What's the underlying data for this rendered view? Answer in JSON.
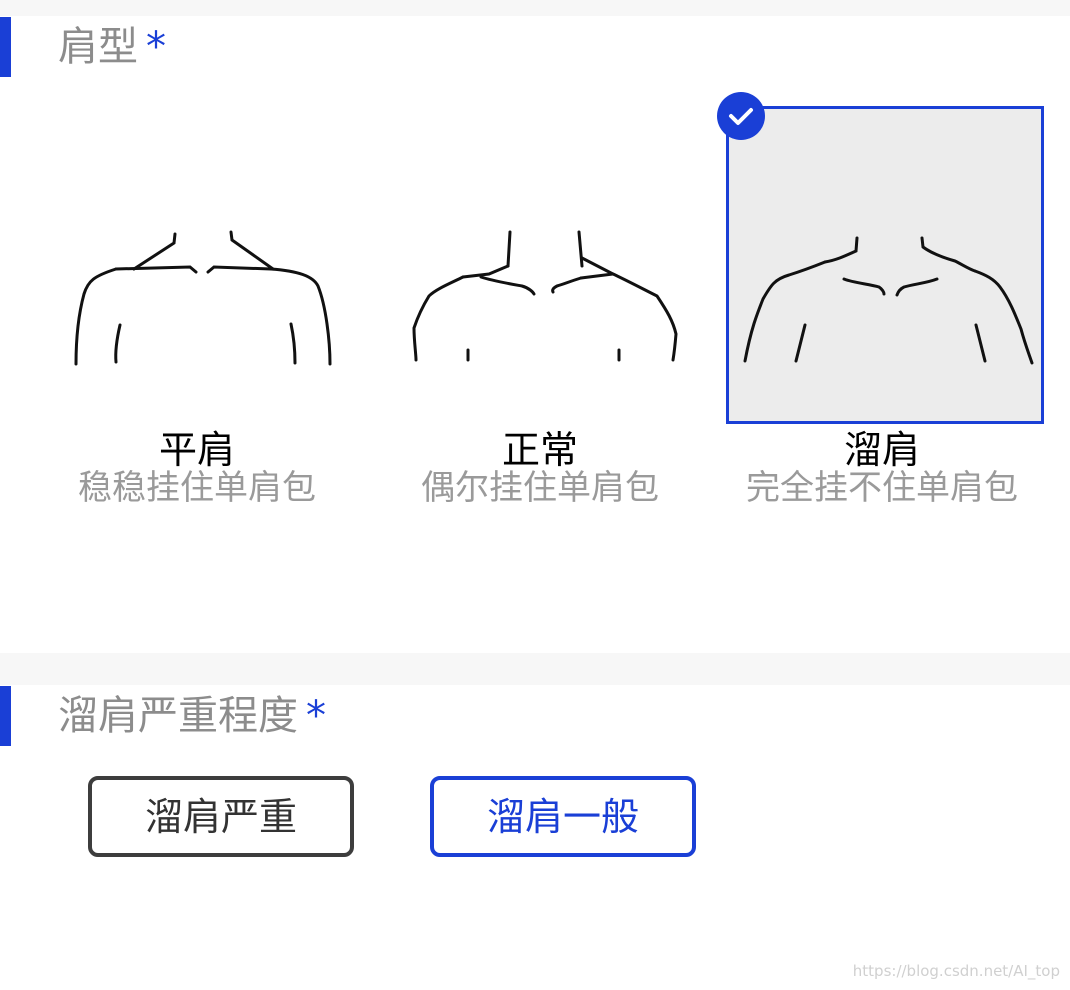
{
  "shoulder_section": {
    "title": "肩型",
    "required_mark": "*",
    "options": [
      {
        "label": "平肩",
        "desc": "稳稳挂住单肩包",
        "selected": false,
        "icon": "flat-shoulder-illustration"
      },
      {
        "label": "正常",
        "desc": "偶尔挂住单肩包",
        "selected": false,
        "icon": "normal-shoulder-illustration"
      },
      {
        "label": "溜肩",
        "desc": "完全挂不住单肩包",
        "selected": true,
        "icon": "sloping-shoulder-illustration"
      }
    ]
  },
  "severity_section": {
    "title": "溜肩严重程度",
    "required_mark": "*",
    "options": [
      {
        "label": "溜肩严重",
        "selected": false
      },
      {
        "label": "溜肩一般",
        "selected": true
      }
    ]
  },
  "watermark": "https://blog.csdn.net/AI_top",
  "colors": {
    "accent": "#1a3fd6",
    "selected_bg": "#ececec",
    "muted_text": "#9a9a9a"
  }
}
